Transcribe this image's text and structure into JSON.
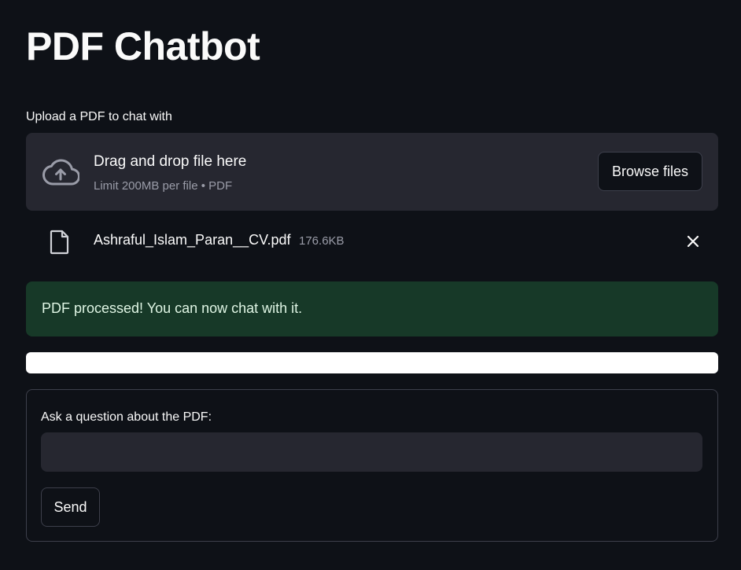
{
  "page": {
    "title": "PDF Chatbot"
  },
  "uploader": {
    "label": "Upload a PDF to chat with",
    "drop_title": "Drag and drop file here",
    "drop_subtitle": "Limit 200MB per file • PDF",
    "browse_label": "Browse files",
    "icon": "cloud-upload-icon"
  },
  "file": {
    "name": "Ashraful_Islam_Paran__CV.pdf",
    "size": "176.6KB",
    "icon": "file-icon",
    "remove_icon": "close-icon"
  },
  "status": {
    "message": "PDF processed! You can now chat with it."
  },
  "progress": {
    "fraction": 1.0
  },
  "chat_form": {
    "question_label": "Ask a question about the PDF:",
    "question_value": "",
    "send_label": "Send"
  },
  "colors": {
    "background": "#0e1117",
    "surface": "#262730",
    "border": "#3d3f4b",
    "success_bg": "#173928",
    "muted_text": "#9a9ca8",
    "text": "#fafafa"
  }
}
